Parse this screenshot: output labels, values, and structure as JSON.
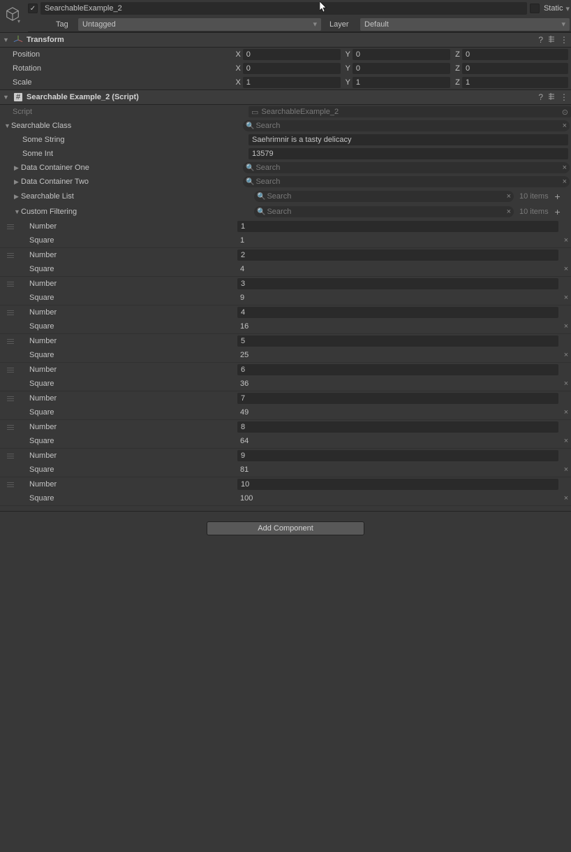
{
  "header": {
    "object_name": "SearchableExample_2",
    "active": true,
    "static": false,
    "static_label": "Static",
    "tag_label": "Tag",
    "tag_value": "Untagged",
    "layer_label": "Layer",
    "layer_value": "Default"
  },
  "transform": {
    "title": "Transform",
    "position_label": "Position",
    "rotation_label": "Rotation",
    "scale_label": "Scale",
    "position": {
      "x": "0",
      "y": "0",
      "z": "0"
    },
    "rotation": {
      "x": "0",
      "y": "0",
      "z": "0"
    },
    "scale": {
      "x": "1",
      "y": "1",
      "z": "1"
    }
  },
  "script_comp": {
    "title": "Searchable Example_2 (Script)",
    "script_label": "Script",
    "script_value": "SearchableExample_2",
    "searchable_class_label": "Searchable Class",
    "some_string_label": "Some String",
    "some_string_value": "Saehrimnir is a tasty delicacy",
    "some_int_label": "Some Int",
    "some_int_value": "13579",
    "data_container_one_label": "Data Container One",
    "data_container_two_label": "Data Container Two",
    "searchable_list_label": "Searchable List",
    "searchable_list_count": "10 items",
    "custom_filtering_label": "Custom Filtering",
    "custom_filtering_count": "10 items",
    "search_placeholder": "Search",
    "number_label": "Number",
    "square_label": "Square",
    "items": [
      {
        "number": "1",
        "square": "1"
      },
      {
        "number": "2",
        "square": "4"
      },
      {
        "number": "3",
        "square": "9"
      },
      {
        "number": "4",
        "square": "16"
      },
      {
        "number": "5",
        "square": "25"
      },
      {
        "number": "6",
        "square": "36"
      },
      {
        "number": "7",
        "square": "49"
      },
      {
        "number": "8",
        "square": "64"
      },
      {
        "number": "9",
        "square": "81"
      },
      {
        "number": "10",
        "square": "100"
      }
    ]
  },
  "add_component_label": "Add Component"
}
